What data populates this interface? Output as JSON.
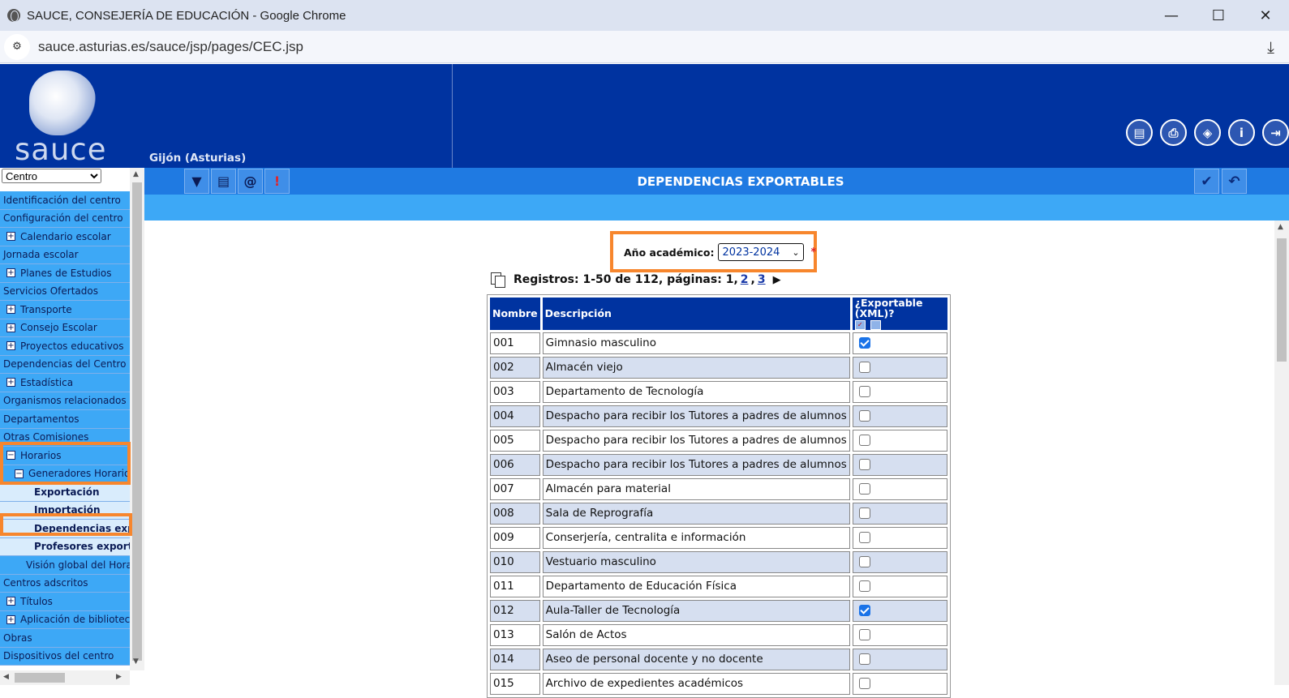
{
  "browser": {
    "window_title": "SAUCE, CONSEJERÍA DE EDUCACIÓN - Google Chrome",
    "url": "sauce.asturias.es/sauce/jsp/pages/CEC.jsp",
    "minimize": "—",
    "maximize": "☐",
    "close": "✕",
    "download": "⤓"
  },
  "header": {
    "logo_text": "sauce",
    "location": "Gijón (Asturias)",
    "icons": [
      "document-icon",
      "print-icon",
      "navigate-icon",
      "info-icon",
      "logout-icon"
    ]
  },
  "sidebar": {
    "selector_value": "Centro",
    "items": [
      {
        "label": "Identificación del centro",
        "level": 0,
        "style": "blue",
        "pm": ""
      },
      {
        "label": "Configuración del centro",
        "level": 0,
        "style": "blue",
        "pm": ""
      },
      {
        "label": "Calendario escolar",
        "level": 1,
        "style": "blue",
        "pm": "+"
      },
      {
        "label": "Jornada escolar",
        "level": 0,
        "style": "blue",
        "pm": ""
      },
      {
        "label": "Planes de Estudios",
        "level": 1,
        "style": "blue",
        "pm": "+"
      },
      {
        "label": "Servicios Ofertados",
        "level": 0,
        "style": "blue",
        "pm": ""
      },
      {
        "label": "Transporte",
        "level": 1,
        "style": "blue",
        "pm": "+"
      },
      {
        "label": "Consejo Escolar",
        "level": 1,
        "style": "blue",
        "pm": "+"
      },
      {
        "label": "Proyectos educativos",
        "level": 1,
        "style": "blue",
        "pm": "+"
      },
      {
        "label": "Dependencias del Centro",
        "level": 0,
        "style": "blue",
        "pm": ""
      },
      {
        "label": "Estadística",
        "level": 1,
        "style": "blue",
        "pm": "+"
      },
      {
        "label": "Organismos relacionados",
        "level": 0,
        "style": "blue",
        "pm": ""
      },
      {
        "label": "Departamentos",
        "level": 0,
        "style": "blue",
        "pm": ""
      },
      {
        "label": "Otras Comisiones",
        "level": 0,
        "style": "blue",
        "pm": ""
      },
      {
        "label": "Horarios",
        "level": 1,
        "style": "blue",
        "pm": "−"
      },
      {
        "label": "Generadores Horarios",
        "level": 2,
        "style": "blue",
        "pm": "−"
      },
      {
        "label": "Exportación",
        "level": 3,
        "style": "light",
        "pm": ""
      },
      {
        "label": "Importación",
        "level": 3,
        "style": "light",
        "pm": ""
      },
      {
        "label": "Dependencias exportables",
        "level": 3,
        "style": "light",
        "pm": ""
      },
      {
        "label": "Profesores exportables",
        "level": 3,
        "style": "light",
        "pm": ""
      },
      {
        "label": "Visión global del Horario",
        "level": 2,
        "style": "blue",
        "pm": ""
      },
      {
        "label": "Centros adscritos",
        "level": 0,
        "style": "blue",
        "pm": ""
      },
      {
        "label": "Títulos",
        "level": 1,
        "style": "blue",
        "pm": "+"
      },
      {
        "label": "Aplicación de biblioteca",
        "level": 1,
        "style": "blue",
        "pm": "+"
      },
      {
        "label": "Obras",
        "level": 0,
        "style": "blue",
        "pm": ""
      },
      {
        "label": "Dispositivos del centro",
        "level": 0,
        "style": "blue",
        "pm": ""
      }
    ]
  },
  "toolbar": {
    "title": "DEPENDENCIAS EXPORTABLES",
    "left_icons": [
      {
        "name": "filter-icon",
        "glyph": "▼"
      },
      {
        "name": "export-txt-csv-icon",
        "glyph": "▤"
      },
      {
        "name": "email-icon",
        "glyph": "@"
      },
      {
        "name": "alert-icon",
        "glyph": "!"
      }
    ],
    "right_icons": [
      {
        "name": "accept-icon",
        "glyph": "✔"
      },
      {
        "name": "undo-icon",
        "glyph": "↶"
      }
    ]
  },
  "form": {
    "anio_label": "Año académico:",
    "anio_value": "2023-2024",
    "required_mark": "*"
  },
  "pagination": {
    "registros_label": "Registros:",
    "range": "1-50 de 112, páginas:",
    "current_page": "1",
    "page2": "2",
    "page3": "3",
    "next": "▶"
  },
  "table": {
    "headers": {
      "nombre": "Nombre",
      "descripcion": "Descripción",
      "exportable": "¿Exportable (XML)?"
    },
    "rows": [
      {
        "nombre": "001",
        "descripcion": "Gimnasio masculino",
        "checked": true
      },
      {
        "nombre": "002",
        "descripcion": "Almacén viejo",
        "checked": false
      },
      {
        "nombre": "003",
        "descripcion": "Departamento de Tecnología",
        "checked": false
      },
      {
        "nombre": "004",
        "descripcion": "Despacho para recibir los Tutores a padres de alumnos",
        "checked": false
      },
      {
        "nombre": "005",
        "descripcion": "Despacho para recibir los Tutores a padres de alumnos",
        "checked": false
      },
      {
        "nombre": "006",
        "descripcion": "Despacho para recibir los Tutores a padres de alumnos",
        "checked": false
      },
      {
        "nombre": "007",
        "descripcion": "Almacén para material",
        "checked": false
      },
      {
        "nombre": "008",
        "descripcion": "Sala de Reprografía",
        "checked": false
      },
      {
        "nombre": "009",
        "descripcion": "Conserjería, centralita e información",
        "checked": false
      },
      {
        "nombre": "010",
        "descripcion": "Vestuario masculino",
        "checked": false
      },
      {
        "nombre": "011",
        "descripcion": "Departamento de Educación Física",
        "checked": false
      },
      {
        "nombre": "012",
        "descripcion": "Aula-Taller de Tecnología",
        "checked": true
      },
      {
        "nombre": "013",
        "descripcion": "Salón de Actos",
        "checked": false
      },
      {
        "nombre": "014",
        "descripcion": "Aseo de personal docente y no docente",
        "checked": false
      },
      {
        "nombre": "015",
        "descripcion": "Archivo de expedientes académicos",
        "checked": false
      }
    ]
  },
  "colors": {
    "header_blue": "#0033a0",
    "toolbar_blue": "#1f7ae2",
    "nav_blue": "#3da8f6",
    "highlight": "#f7862d"
  }
}
